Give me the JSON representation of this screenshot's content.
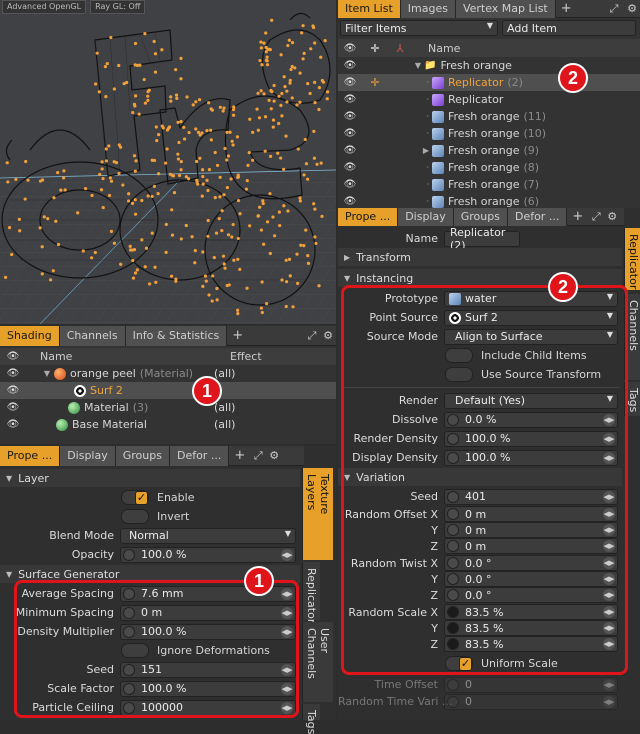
{
  "viewport": {
    "labels": [
      "Advanced OpenGL",
      "Ray GL: Off"
    ]
  },
  "item_list": {
    "tabs": [
      "Item List",
      "Images",
      "Vertex Map List"
    ],
    "filter_label": "Filter Items",
    "add_item_label": "Add Item",
    "name_header": "Name",
    "rows": [
      {
        "label": "Fresh orange",
        "suffix": "",
        "kind": "group"
      },
      {
        "label": "Replicator",
        "suffix": "(2)",
        "kind": "replicator-selected"
      },
      {
        "label": "Replicator",
        "suffix": "",
        "kind": "replicator"
      },
      {
        "label": "Fresh orange",
        "suffix": "(11)",
        "kind": "mesh"
      },
      {
        "label": "Fresh orange",
        "suffix": "(10)",
        "kind": "mesh"
      },
      {
        "label": "Fresh orange",
        "suffix": "(9)",
        "kind": "mesh"
      },
      {
        "label": "Fresh orange",
        "suffix": "(8)",
        "kind": "mesh"
      },
      {
        "label": "Fresh orange",
        "suffix": "(7)",
        "kind": "mesh"
      },
      {
        "label": "Fresh orange",
        "suffix": "(6)",
        "kind": "mesh"
      }
    ]
  },
  "shading": {
    "tabs": [
      "Shading",
      "Channels",
      "Info & Statistics"
    ],
    "headers": {
      "name": "Name",
      "effect": "Effect"
    },
    "rows": [
      {
        "label": "orange peel",
        "suffix": "(Material)",
        "effect": "(all)"
      },
      {
        "label": "Surf 2",
        "suffix": "",
        "effect": ""
      },
      {
        "label": "Material",
        "suffix": "(3)",
        "effect": "(all)"
      },
      {
        "label": "Base Material",
        "suffix": "",
        "effect": "(all)"
      }
    ]
  },
  "left_props": {
    "tabs": [
      "Prope ...",
      "Display",
      "Groups",
      "Defor ..."
    ],
    "side_tabs": [
      "Texture Layers",
      "Replicator",
      "User Channels",
      "Tags"
    ],
    "layer_section": "Layer",
    "enable": "Enable",
    "invert": "Invert",
    "blend_mode_label": "Blend Mode",
    "blend_mode": "Normal",
    "opacity_label": "Opacity",
    "opacity": "100.0 %",
    "surface_section": "Surface Generator",
    "avg_spacing_label": "Average Spacing",
    "avg_spacing": "7.6 mm",
    "min_spacing_label": "Minimum Spacing",
    "min_spacing": "0 m",
    "density_label": "Density Multiplier",
    "density": "100.0 %",
    "ignore_def": "Ignore Deformations",
    "seed_label": "Seed",
    "seed": "151",
    "scale_label": "Scale Factor",
    "scale": "100.0 %",
    "ceiling_label": "Particle Ceiling",
    "ceiling": "100000"
  },
  "right_props": {
    "tabs": [
      "Prope ...",
      "Display",
      "Groups",
      "Defor ..."
    ],
    "side_tabs": [
      "Replicator",
      "User Channels",
      "Tags"
    ],
    "name_label": "Name",
    "name": "Replicator (2)",
    "transform_section": "Transform",
    "instancing_section": "Instancing",
    "prototype_label": "Prototype",
    "prototype": "water",
    "point_source_label": "Point Source",
    "point_source": "Surf 2",
    "source_mode_label": "Source Mode",
    "source_mode": "Align to Surface",
    "include_child": "Include Child Items",
    "use_source_transform": "Use Source Transform",
    "render_label": "Render",
    "render": "Default (Yes)",
    "dissolve_label": "Dissolve",
    "dissolve": "0.0 %",
    "render_density_label": "Render Density",
    "render_density": "100.0 %",
    "display_density_label": "Display Density",
    "display_density": "100.0 %",
    "variation_section": "Variation",
    "seed_label": "Seed",
    "seed": "401",
    "rand_offset_label": "Random Offset X",
    "rand_offset": [
      "0 m",
      "0 m",
      "0 m"
    ],
    "rand_twist_label": "Random Twist X",
    "rand_twist": [
      "0.0 °",
      "0.0 °",
      "0.0 °"
    ],
    "rand_scale_label": "Random Scale X",
    "rand_scale": [
      "83.5 %",
      "83.5 %",
      "83.5 %"
    ],
    "axis_y": "Y",
    "axis_z": "Z",
    "uniform_scale": "Uniform Scale",
    "time_offset_label": "Time Offset",
    "time_offset": "0",
    "random_time_label": "Random Time Vari ...",
    "random_time": "0"
  },
  "badges": [
    "1",
    "2"
  ],
  "colors": {
    "accent": "#e7a02a",
    "highlight_red": "#e0151b",
    "orange_text": "#f0a23a"
  }
}
